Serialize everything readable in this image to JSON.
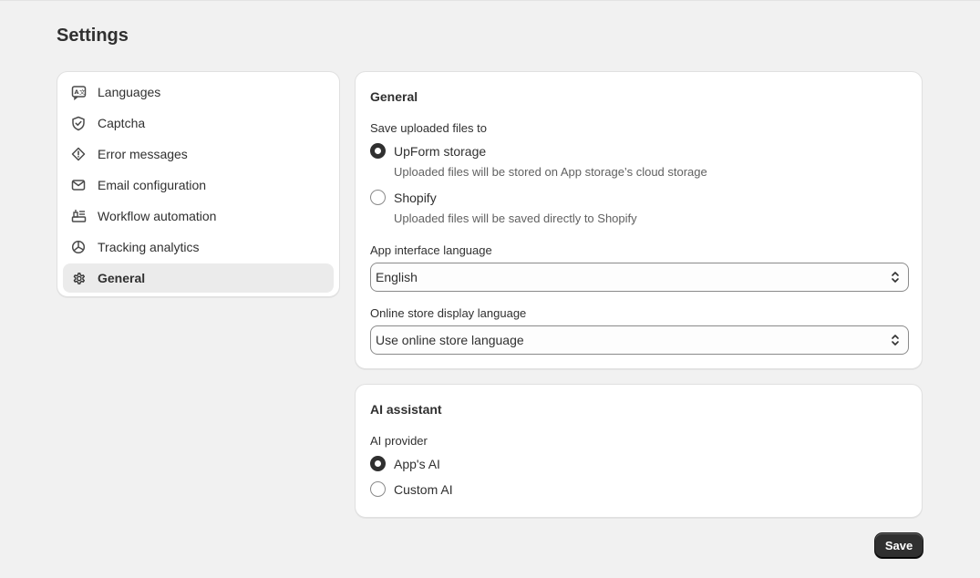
{
  "page": {
    "title": "Settings"
  },
  "sidebar": {
    "items": [
      {
        "label": "Languages",
        "icon": "language-icon"
      },
      {
        "label": "Captcha",
        "icon": "shield-check-icon"
      },
      {
        "label": "Error messages",
        "icon": "alert-diamond-icon"
      },
      {
        "label": "Email configuration",
        "icon": "email-icon"
      },
      {
        "label": "Workflow automation",
        "icon": "workflow-icon"
      },
      {
        "label": "Tracking analytics",
        "icon": "analytics-pie-icon"
      },
      {
        "label": "General",
        "icon": "gear-icon",
        "active": true
      }
    ]
  },
  "general": {
    "title": "General",
    "storage_label": "Save uploaded files to",
    "storage_options": [
      {
        "label": "UpForm storage",
        "help": "Uploaded files will be stored on App storage’s cloud storage",
        "checked": true
      },
      {
        "label": "Shopify",
        "help": "Uploaded files will be saved directly to Shopify",
        "checked": false
      }
    ],
    "interface_language_label": "App interface language",
    "interface_language_value": "English",
    "store_language_label": "Online store display language",
    "store_language_value": "Use online store language"
  },
  "ai": {
    "title": "AI assistant",
    "provider_label": "AI provider",
    "options": [
      {
        "label": "App's AI",
        "checked": true
      },
      {
        "label": "Custom AI",
        "checked": false
      }
    ]
  },
  "actions": {
    "save_label": "Save"
  },
  "colors": {
    "background": "#f1f1f1",
    "card": "#ffffff",
    "primary_button": "#303030",
    "active_nav": "#ebebeb"
  }
}
